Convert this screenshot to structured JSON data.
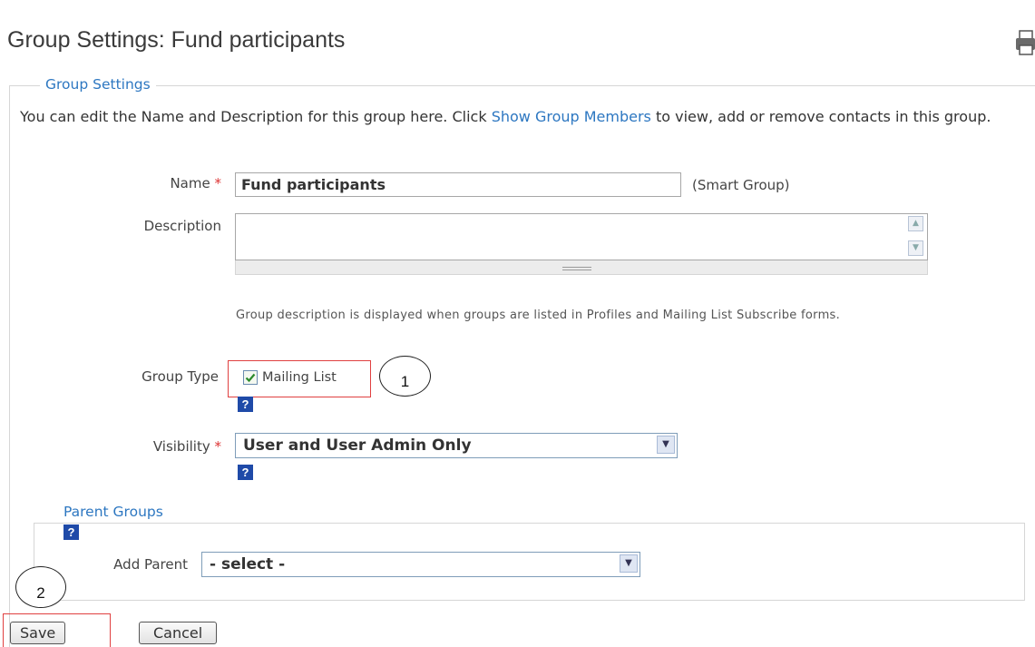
{
  "page": {
    "title": "Group Settings: Fund participants"
  },
  "group_settings": {
    "legend": "Group Settings",
    "intro_before": "You can edit the Name and Description for this group here. Click ",
    "intro_link": "Show Group Members",
    "intro_after": " to view, add or remove contacts in this group.",
    "name_label": "Name",
    "required_mark": "*",
    "name_value": "Fund participants",
    "smart_group_note": "(Smart Group)",
    "description_label": "Description",
    "description_value": "",
    "description_help": "Group description is displayed when groups are listed in Profiles and Mailing List Subscribe forms.",
    "group_type_label": "Group Type",
    "mailing_list_label": "Mailing List",
    "mailing_list_checked": true,
    "visibility_label": "Visibility",
    "visibility_value": "User and User Admin Only"
  },
  "parent_groups": {
    "legend": "Parent Groups",
    "add_parent_label": "Add Parent",
    "add_parent_value": "- select -"
  },
  "buttons": {
    "save": "Save",
    "cancel": "Cancel"
  },
  "annotations": {
    "marker_1": "1",
    "marker_2": "2"
  },
  "icons": {
    "help": "?",
    "checkmark": "✔",
    "dropdown": "▼",
    "scroll_up": "▲",
    "scroll_down": "▼"
  },
  "colors": {
    "accent": "#2d77c1",
    "required": "#dd3333",
    "highlight": "#e04040",
    "help_icon": "#1f4aa8"
  }
}
